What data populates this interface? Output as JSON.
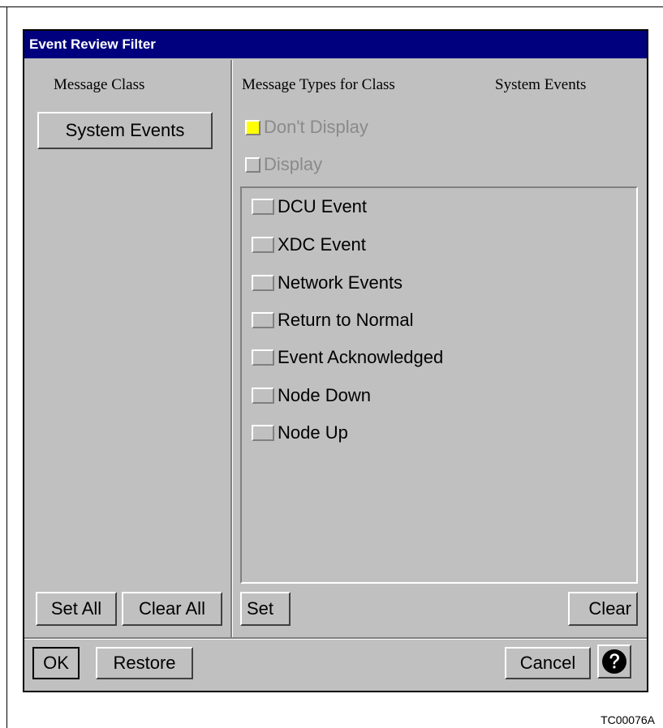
{
  "dialog": {
    "title": "Event Review Filter",
    "left_panel": {
      "heading": "Message Class",
      "selected_class": "System Events",
      "set_all_label": "Set All",
      "clear_all_label": "Clear All"
    },
    "right_panel": {
      "heading": "Message Types for Class",
      "class_name": "System Events",
      "dont_display_label": "Don't Display",
      "dont_display_indicator_color": "#ffff00",
      "display_label": "Display",
      "types": [
        {
          "label": "DCU Event",
          "checked": false
        },
        {
          "label": "XDC Event",
          "checked": false
        },
        {
          "label": "Network Events",
          "checked": false
        },
        {
          "label": "Return to Normal",
          "checked": false
        },
        {
          "label": "Event Acknowledged",
          "checked": false
        },
        {
          "label": "Node Down",
          "checked": false
        },
        {
          "label": "Node Up",
          "checked": false
        }
      ],
      "set_label": "Set",
      "clear_label": "Clear"
    },
    "footer": {
      "ok_label": "OK",
      "restore_label": "Restore",
      "cancel_label": "Cancel",
      "help_icon": "question-mark-icon"
    },
    "title_bar_color": "#00007f"
  },
  "figure_id": "TC00076A"
}
